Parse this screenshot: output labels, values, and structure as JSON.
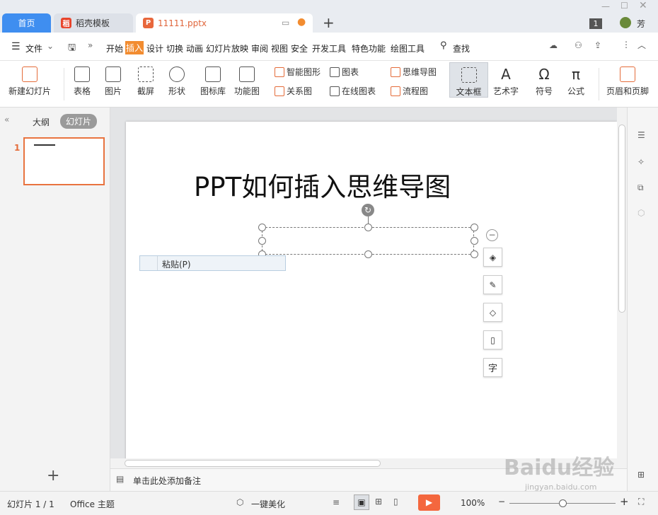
{
  "tabs": {
    "home": "首页",
    "template": "稻壳模板",
    "doc": "11111.pptx",
    "add": "+"
  },
  "window": {
    "badge": "1",
    "user": "芳"
  },
  "menubar": {
    "file": "文件",
    "items": [
      "开始",
      "插入",
      "设计",
      "切换",
      "动画",
      "幻灯片放映",
      "审阅",
      "视图",
      "安全",
      "开发工具",
      "特色功能",
      "绘图工具"
    ],
    "search": "查找"
  },
  "ribbon": {
    "new_slide": "新建幻灯片",
    "table": "表格",
    "picture": "图片",
    "screenshot": "截屏",
    "shape": "形状",
    "icon_lib": "图标库",
    "function_chart": "功能图",
    "smart_shape": "智能图形",
    "chart": "图表",
    "relation": "关系图",
    "online_chart": "在线图表",
    "mindmap": "思维导图",
    "flowchart": "流程图",
    "textbox": "文本框",
    "wordart": "艺术字",
    "symbol": "符号",
    "formula": "公式",
    "header_footer": "页眉和页脚"
  },
  "leftpanel": {
    "outline": "大纲",
    "slides": "幻灯片",
    "slide_num": "1",
    "add": "+"
  },
  "slide": {
    "title": "PPT如何插入思维导图"
  },
  "context_menu": {
    "paste": "粘贴(P)"
  },
  "notes": {
    "placeholder": "单击此处添加备注"
  },
  "status": {
    "slide_count": "幻灯片 1 / 1",
    "theme": "Office 主题",
    "beautify": "一键美化",
    "zoom": "100%"
  },
  "watermark": {
    "brand": "Baidu经验",
    "url": "jingyan.baidu.com"
  },
  "colors": {
    "accent": "#f28c30",
    "home_tab": "#3f8ef0",
    "play": "#f4673e"
  }
}
